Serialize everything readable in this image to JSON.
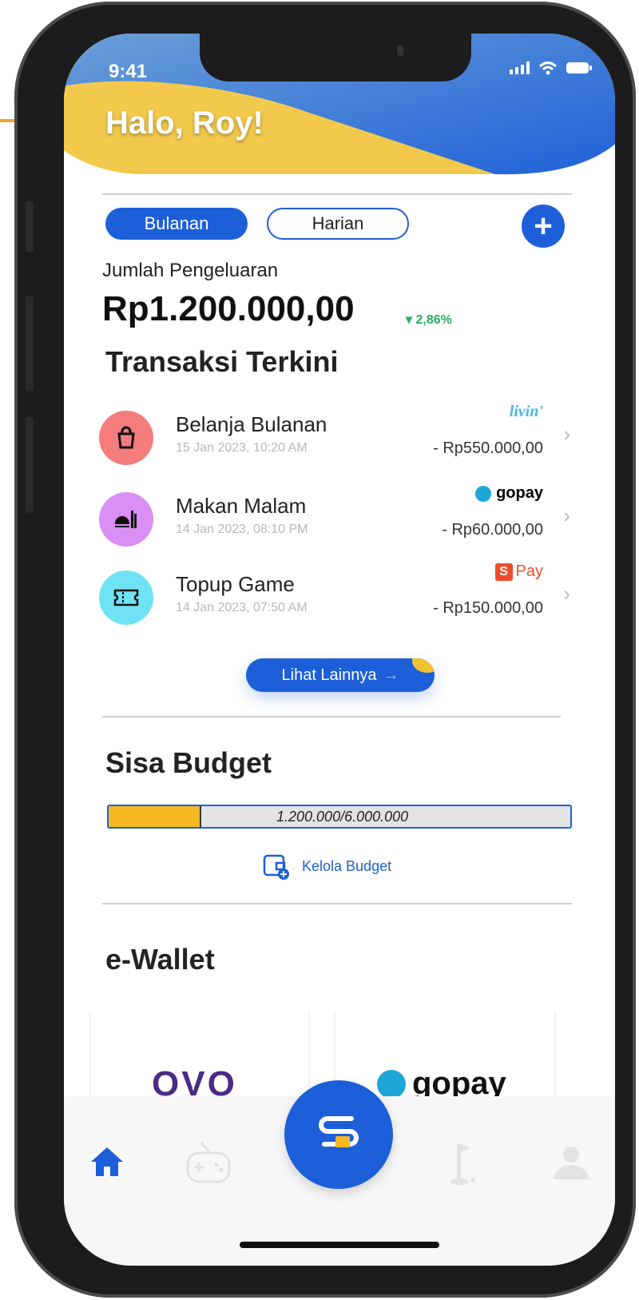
{
  "status": {
    "time": "9:41"
  },
  "greeting": "Halo, Roy!",
  "tabs": {
    "monthly": "Bulanan",
    "daily": "Harian"
  },
  "summary": {
    "label": "Jumlah Pengeluaran",
    "amount": "Rp1.200.000,00",
    "change": "▾ 2,86%"
  },
  "transactions": {
    "title": "Transaksi Terkini",
    "items": [
      {
        "name": "Belanja Bulanan",
        "date": "15 Jan 2023, 10:20 AM",
        "amount": "- Rp550.000,00",
        "source": "livin'",
        "icon": "shopping-bag-icon",
        "color": "#f47c7c"
      },
      {
        "name": "Makan Malam",
        "date": "14 Jan 2023, 08:10 PM",
        "amount": "- Rp60.000,00",
        "source": "gopay",
        "icon": "food-icon",
        "color": "#d98ff3"
      },
      {
        "name": "Topup Game",
        "date": "14 Jan 2023, 07:50 AM",
        "amount": "- Rp150.000,00",
        "source": "Pay",
        "icon": "ticket-icon",
        "color": "#6fe3f5"
      }
    ],
    "more_label": "Lihat Lainnya"
  },
  "budget": {
    "title": "Sisa Budget",
    "progress_text": "1.200.000/6.000.000",
    "used_fraction": 0.2,
    "manage_label": "Kelola Budget"
  },
  "ewallet": {
    "title": "e-Wallet",
    "wallets": [
      "OVO",
      "gopay"
    ]
  },
  "nav": [
    "home-icon",
    "game-icon",
    "wallet-logo-icon",
    "golf-icon",
    "profile-icon"
  ],
  "colors": {
    "primary": "#1d5fd9",
    "accent": "#f5b820",
    "positive": "#27ae60"
  }
}
